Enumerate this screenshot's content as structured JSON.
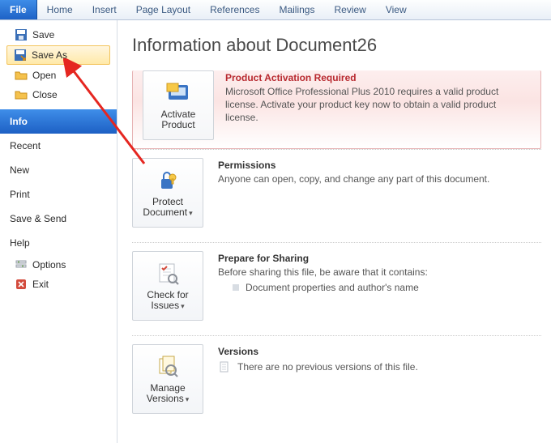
{
  "ribbon": {
    "tabs": [
      "File",
      "Home",
      "Insert",
      "Page Layout",
      "References",
      "Mailings",
      "Review",
      "View"
    ],
    "activeIndex": 0
  },
  "sidebar": {
    "top": [
      {
        "label": "Save",
        "icon": "save"
      },
      {
        "label": "Save As",
        "icon": "saveas",
        "highlighted": true
      },
      {
        "label": "Open",
        "icon": "open"
      },
      {
        "label": "Close",
        "icon": "close"
      }
    ],
    "mid": [
      {
        "label": "Info",
        "selected": true
      },
      {
        "label": "Recent"
      },
      {
        "label": "New"
      },
      {
        "label": "Print"
      },
      {
        "label": "Save & Send"
      },
      {
        "label": "Help"
      }
    ],
    "bottom": [
      {
        "label": "Options",
        "icon": "options"
      },
      {
        "label": "Exit",
        "icon": "exit"
      }
    ]
  },
  "page": {
    "title": "Information about Document26"
  },
  "activation": {
    "title": "Product Activation Required",
    "text": "Microsoft Office Professional Plus 2010 requires a valid product license. Activate your product key now to obtain a valid product license.",
    "button": "Activate Product"
  },
  "permissions": {
    "title": "Permissions",
    "text": "Anyone can open, copy, and change any part of this document.",
    "button": "Protect Document"
  },
  "sharing": {
    "title": "Prepare for Sharing",
    "intro": "Before sharing this file, be aware that it contains:",
    "bullet": "Document properties and author's name",
    "button": "Check for Issues"
  },
  "versions": {
    "title": "Versions",
    "text": "There are no previous versions of this file.",
    "button": "Manage Versions"
  }
}
